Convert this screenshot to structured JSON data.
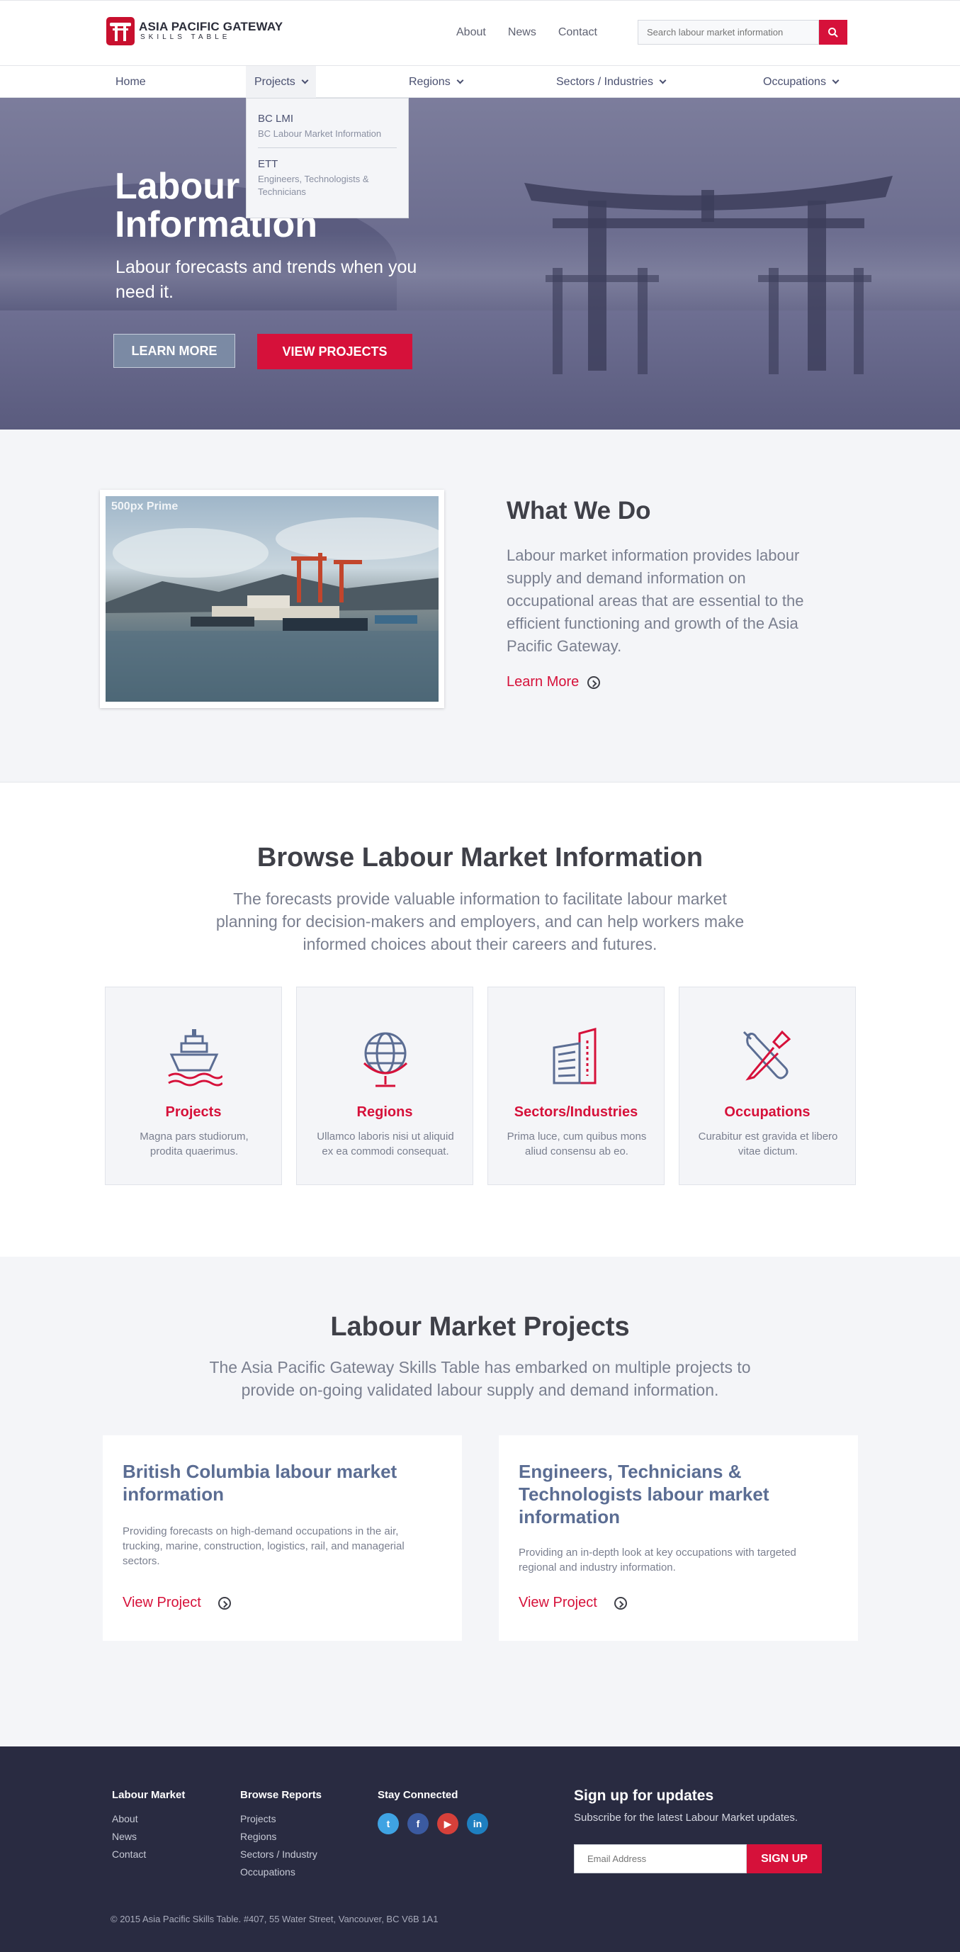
{
  "header": {
    "logo_title": "ASIA PACIFIC GATEWAY",
    "logo_subtitle": "SKILLS TABLE",
    "top_links": [
      "About",
      "News",
      "Contact"
    ],
    "search_placeholder": "Search labour market information"
  },
  "nav": {
    "items": [
      "Home",
      "Projects",
      "Regions",
      "Sectors / Industries",
      "Occupations"
    ],
    "active": "Projects"
  },
  "dropdown": {
    "items": [
      {
        "title": "BC LMI",
        "subtitle": "BC Labour Market Information"
      },
      {
        "title": "ETT",
        "subtitle": "Engineers, Technologists & Technicians"
      }
    ]
  },
  "hero": {
    "title_line1": "Labour",
    "title_line2": "Information",
    "subtitle": "Labour forecasts and trends when you need it.",
    "learn_more": "LEARN MORE",
    "view_projects": "VIEW PROJECTS"
  },
  "what_we_do": {
    "watermark": "500px Prime",
    "title": "What We Do",
    "text": "Labour market information provides labour supply and demand information on occupational areas that are essential to the efficient functioning and growth of the Asia Pacific Gateway.",
    "link": "Learn More"
  },
  "browse": {
    "title": "Browse Labour Market Information",
    "text": "The forecasts provide valuable information to facilitate labour market planning for decision-makers and employers, and can help workers make informed choices about their careers and futures.",
    "cards": [
      {
        "title": "Projects",
        "text": "Magna pars studiorum, prodita quaerimus.",
        "icon": "ship-icon"
      },
      {
        "title": "Regions",
        "text": "Ullamco laboris nisi ut aliquid ex ea commodi consequat.",
        "icon": "globe-icon"
      },
      {
        "title": "Sectors/Industries",
        "text": "Prima luce, cum quibus mons aliud consensu ab eo.",
        "icon": "building-icon"
      },
      {
        "title": "Occupations",
        "text": "Curabitur est gravida et libero vitae dictum.",
        "icon": "tools-icon"
      }
    ]
  },
  "projects": {
    "title": "Labour Market Projects",
    "text": "The Asia Pacific Gateway Skills Table has embarked on multiple projects to provide on-going validated labour supply and demand information.",
    "cards": [
      {
        "title": "British Columbia labour market information",
        "text": "Providing forecasts on high-demand occupations in the air, trucking, marine, construction, logistics, rail, and managerial sectors.",
        "link": "View Project"
      },
      {
        "title": "Engineers, Technicians & Technologists labour market information",
        "text": "Providing an in-depth look at key occupations with targeted regional and industry information.",
        "link": "View Project"
      }
    ]
  },
  "footer": {
    "col1": {
      "title": "Labour Market",
      "items": [
        "About",
        "News",
        "Contact"
      ]
    },
    "col2": {
      "title": "Browse Reports",
      "items": [
        "Projects",
        "Regions",
        "Sectors / Industry",
        "Occupations"
      ]
    },
    "col3": {
      "title": "Stay Connected",
      "social": [
        "twitter-icon",
        "facebook-icon",
        "youtube-icon",
        "linkedin-icon"
      ]
    },
    "signup_title": "Sign up for updates",
    "signup_sub": "Subscribe for the latest Labour Market updates.",
    "email_placeholder": "Email Address",
    "signup_button": "SIGN UP",
    "copyright": "© 2015 Asia Pacific Skills Table. #407, 55 Water Street, Vancouver, BC V6B 1A1"
  },
  "colors": {
    "accent": "#d6113a",
    "dark": "#292b41",
    "hero": "#6b6c8e",
    "light_bg": "#f4f5f8"
  }
}
